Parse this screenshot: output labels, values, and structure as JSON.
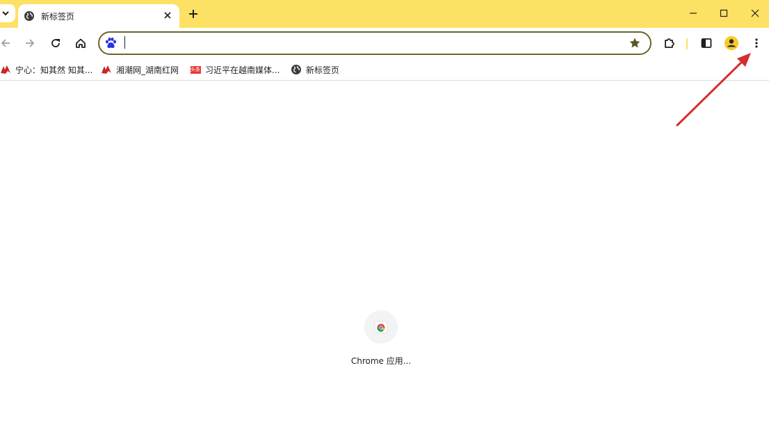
{
  "tab": {
    "title": "新标签页"
  },
  "omnibox": {
    "value": "",
    "placeholder": ""
  },
  "bookmarks": [
    {
      "label": "宁心：知其然 知其..."
    },
    {
      "label": "湘潮网_湖南红网"
    },
    {
      "label": "习近平在越南媒体...",
      "badge": "头条"
    },
    {
      "label": "新标签页"
    }
  ],
  "shortcut": {
    "label": "Chrome 应用..."
  },
  "colors": {
    "tabstrip": "#fde165",
    "omnibox_border": "#6d6424",
    "annotation_arrow": "#d32f2f"
  }
}
